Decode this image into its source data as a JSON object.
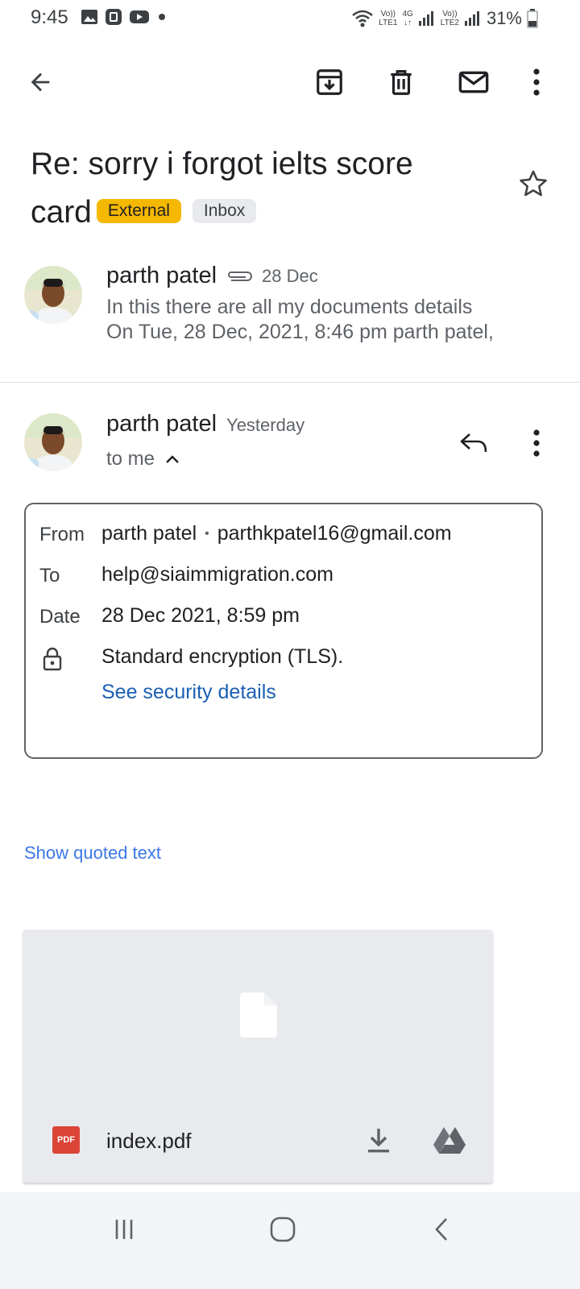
{
  "status_bar": {
    "time": "9:45",
    "lte1_label": "LTE1",
    "net_label": "4G",
    "lte2_label": "LTE2",
    "battery": "31%"
  },
  "toolbar": {
    "back": "arrow-back-icon",
    "archive": "archive-icon",
    "delete": "trash-icon",
    "mark_unread": "mail-icon",
    "more": "more-vert-icon"
  },
  "email": {
    "subject": "Re: sorry i forgot ielts score card",
    "subject_line1": "Re: sorry i forgot ielts score",
    "subject_line2": "card",
    "labels": [
      "External",
      "Inbox"
    ]
  },
  "thread": [
    {
      "sender": "parth patel",
      "date": "28 Dec",
      "snippet_line1": "In this there are all my documents details",
      "snippet_line2": "On Tue, 28 Dec, 2021, 8:46 pm parth patel,"
    },
    {
      "sender": "parth patel",
      "date": "Yesterday",
      "recipient": "to me"
    }
  ],
  "details": {
    "from_label": "From",
    "from_name": "parth patel",
    "from_email": "parthkpatel16@gmail.com",
    "to_label": "To",
    "to_value": "help@siaimmigration.com",
    "date_label": "Date",
    "date_value": "28 Dec 2021, 8:59 pm",
    "encryption": "Standard encryption (TLS).",
    "security_link": "See security details"
  },
  "show_quoted": "Show quoted text",
  "attachment": {
    "type_badge": "PDF",
    "filename": "index.pdf"
  },
  "colors": {
    "external_chip": "#f5b800",
    "link": "#1a5fb4",
    "pdf_red": "#db4437"
  }
}
